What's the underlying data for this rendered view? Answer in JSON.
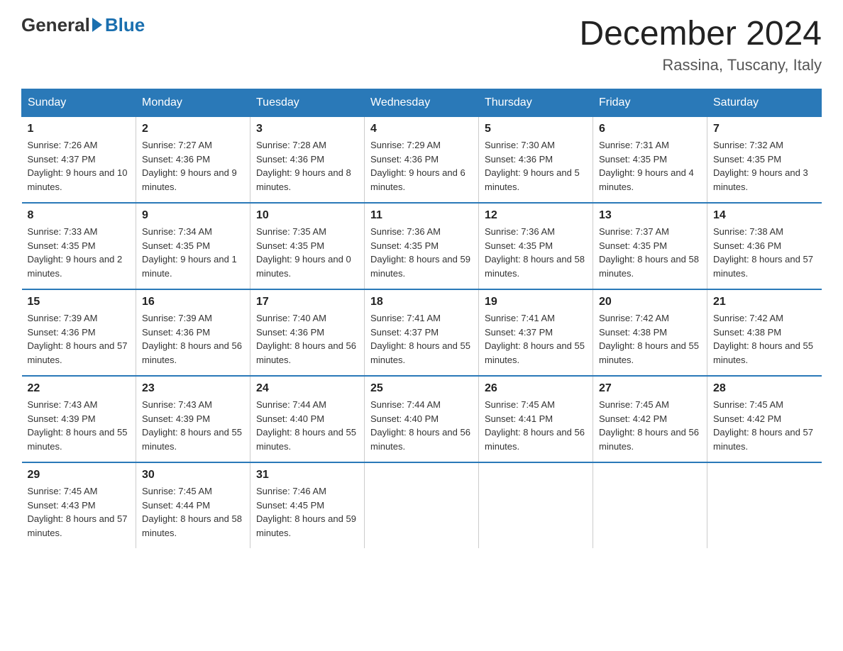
{
  "header": {
    "logo_general": "General",
    "logo_blue": "Blue",
    "month_title": "December 2024",
    "location": "Rassina, Tuscany, Italy"
  },
  "days_of_week": [
    "Sunday",
    "Monday",
    "Tuesday",
    "Wednesday",
    "Thursday",
    "Friday",
    "Saturday"
  ],
  "weeks": [
    [
      {
        "num": "1",
        "sunrise": "7:26 AM",
        "sunset": "4:37 PM",
        "daylight": "9 hours and 10 minutes."
      },
      {
        "num": "2",
        "sunrise": "7:27 AM",
        "sunset": "4:36 PM",
        "daylight": "9 hours and 9 minutes."
      },
      {
        "num": "3",
        "sunrise": "7:28 AM",
        "sunset": "4:36 PM",
        "daylight": "9 hours and 8 minutes."
      },
      {
        "num": "4",
        "sunrise": "7:29 AM",
        "sunset": "4:36 PM",
        "daylight": "9 hours and 6 minutes."
      },
      {
        "num": "5",
        "sunrise": "7:30 AM",
        "sunset": "4:36 PM",
        "daylight": "9 hours and 5 minutes."
      },
      {
        "num": "6",
        "sunrise": "7:31 AM",
        "sunset": "4:35 PM",
        "daylight": "9 hours and 4 minutes."
      },
      {
        "num": "7",
        "sunrise": "7:32 AM",
        "sunset": "4:35 PM",
        "daylight": "9 hours and 3 minutes."
      }
    ],
    [
      {
        "num": "8",
        "sunrise": "7:33 AM",
        "sunset": "4:35 PM",
        "daylight": "9 hours and 2 minutes."
      },
      {
        "num": "9",
        "sunrise": "7:34 AM",
        "sunset": "4:35 PM",
        "daylight": "9 hours and 1 minute."
      },
      {
        "num": "10",
        "sunrise": "7:35 AM",
        "sunset": "4:35 PM",
        "daylight": "9 hours and 0 minutes."
      },
      {
        "num": "11",
        "sunrise": "7:36 AM",
        "sunset": "4:35 PM",
        "daylight": "8 hours and 59 minutes."
      },
      {
        "num": "12",
        "sunrise": "7:36 AM",
        "sunset": "4:35 PM",
        "daylight": "8 hours and 58 minutes."
      },
      {
        "num": "13",
        "sunrise": "7:37 AM",
        "sunset": "4:35 PM",
        "daylight": "8 hours and 58 minutes."
      },
      {
        "num": "14",
        "sunrise": "7:38 AM",
        "sunset": "4:36 PM",
        "daylight": "8 hours and 57 minutes."
      }
    ],
    [
      {
        "num": "15",
        "sunrise": "7:39 AM",
        "sunset": "4:36 PM",
        "daylight": "8 hours and 57 minutes."
      },
      {
        "num": "16",
        "sunrise": "7:39 AM",
        "sunset": "4:36 PM",
        "daylight": "8 hours and 56 minutes."
      },
      {
        "num": "17",
        "sunrise": "7:40 AM",
        "sunset": "4:36 PM",
        "daylight": "8 hours and 56 minutes."
      },
      {
        "num": "18",
        "sunrise": "7:41 AM",
        "sunset": "4:37 PM",
        "daylight": "8 hours and 55 minutes."
      },
      {
        "num": "19",
        "sunrise": "7:41 AM",
        "sunset": "4:37 PM",
        "daylight": "8 hours and 55 minutes."
      },
      {
        "num": "20",
        "sunrise": "7:42 AM",
        "sunset": "4:38 PM",
        "daylight": "8 hours and 55 minutes."
      },
      {
        "num": "21",
        "sunrise": "7:42 AM",
        "sunset": "4:38 PM",
        "daylight": "8 hours and 55 minutes."
      }
    ],
    [
      {
        "num": "22",
        "sunrise": "7:43 AM",
        "sunset": "4:39 PM",
        "daylight": "8 hours and 55 minutes."
      },
      {
        "num": "23",
        "sunrise": "7:43 AM",
        "sunset": "4:39 PM",
        "daylight": "8 hours and 55 minutes."
      },
      {
        "num": "24",
        "sunrise": "7:44 AM",
        "sunset": "4:40 PM",
        "daylight": "8 hours and 55 minutes."
      },
      {
        "num": "25",
        "sunrise": "7:44 AM",
        "sunset": "4:40 PM",
        "daylight": "8 hours and 56 minutes."
      },
      {
        "num": "26",
        "sunrise": "7:45 AM",
        "sunset": "4:41 PM",
        "daylight": "8 hours and 56 minutes."
      },
      {
        "num": "27",
        "sunrise": "7:45 AM",
        "sunset": "4:42 PM",
        "daylight": "8 hours and 56 minutes."
      },
      {
        "num": "28",
        "sunrise": "7:45 AM",
        "sunset": "4:42 PM",
        "daylight": "8 hours and 57 minutes."
      }
    ],
    [
      {
        "num": "29",
        "sunrise": "7:45 AM",
        "sunset": "4:43 PM",
        "daylight": "8 hours and 57 minutes."
      },
      {
        "num": "30",
        "sunrise": "7:45 AM",
        "sunset": "4:44 PM",
        "daylight": "8 hours and 58 minutes."
      },
      {
        "num": "31",
        "sunrise": "7:46 AM",
        "sunset": "4:45 PM",
        "daylight": "8 hours and 59 minutes."
      },
      null,
      null,
      null,
      null
    ]
  ]
}
